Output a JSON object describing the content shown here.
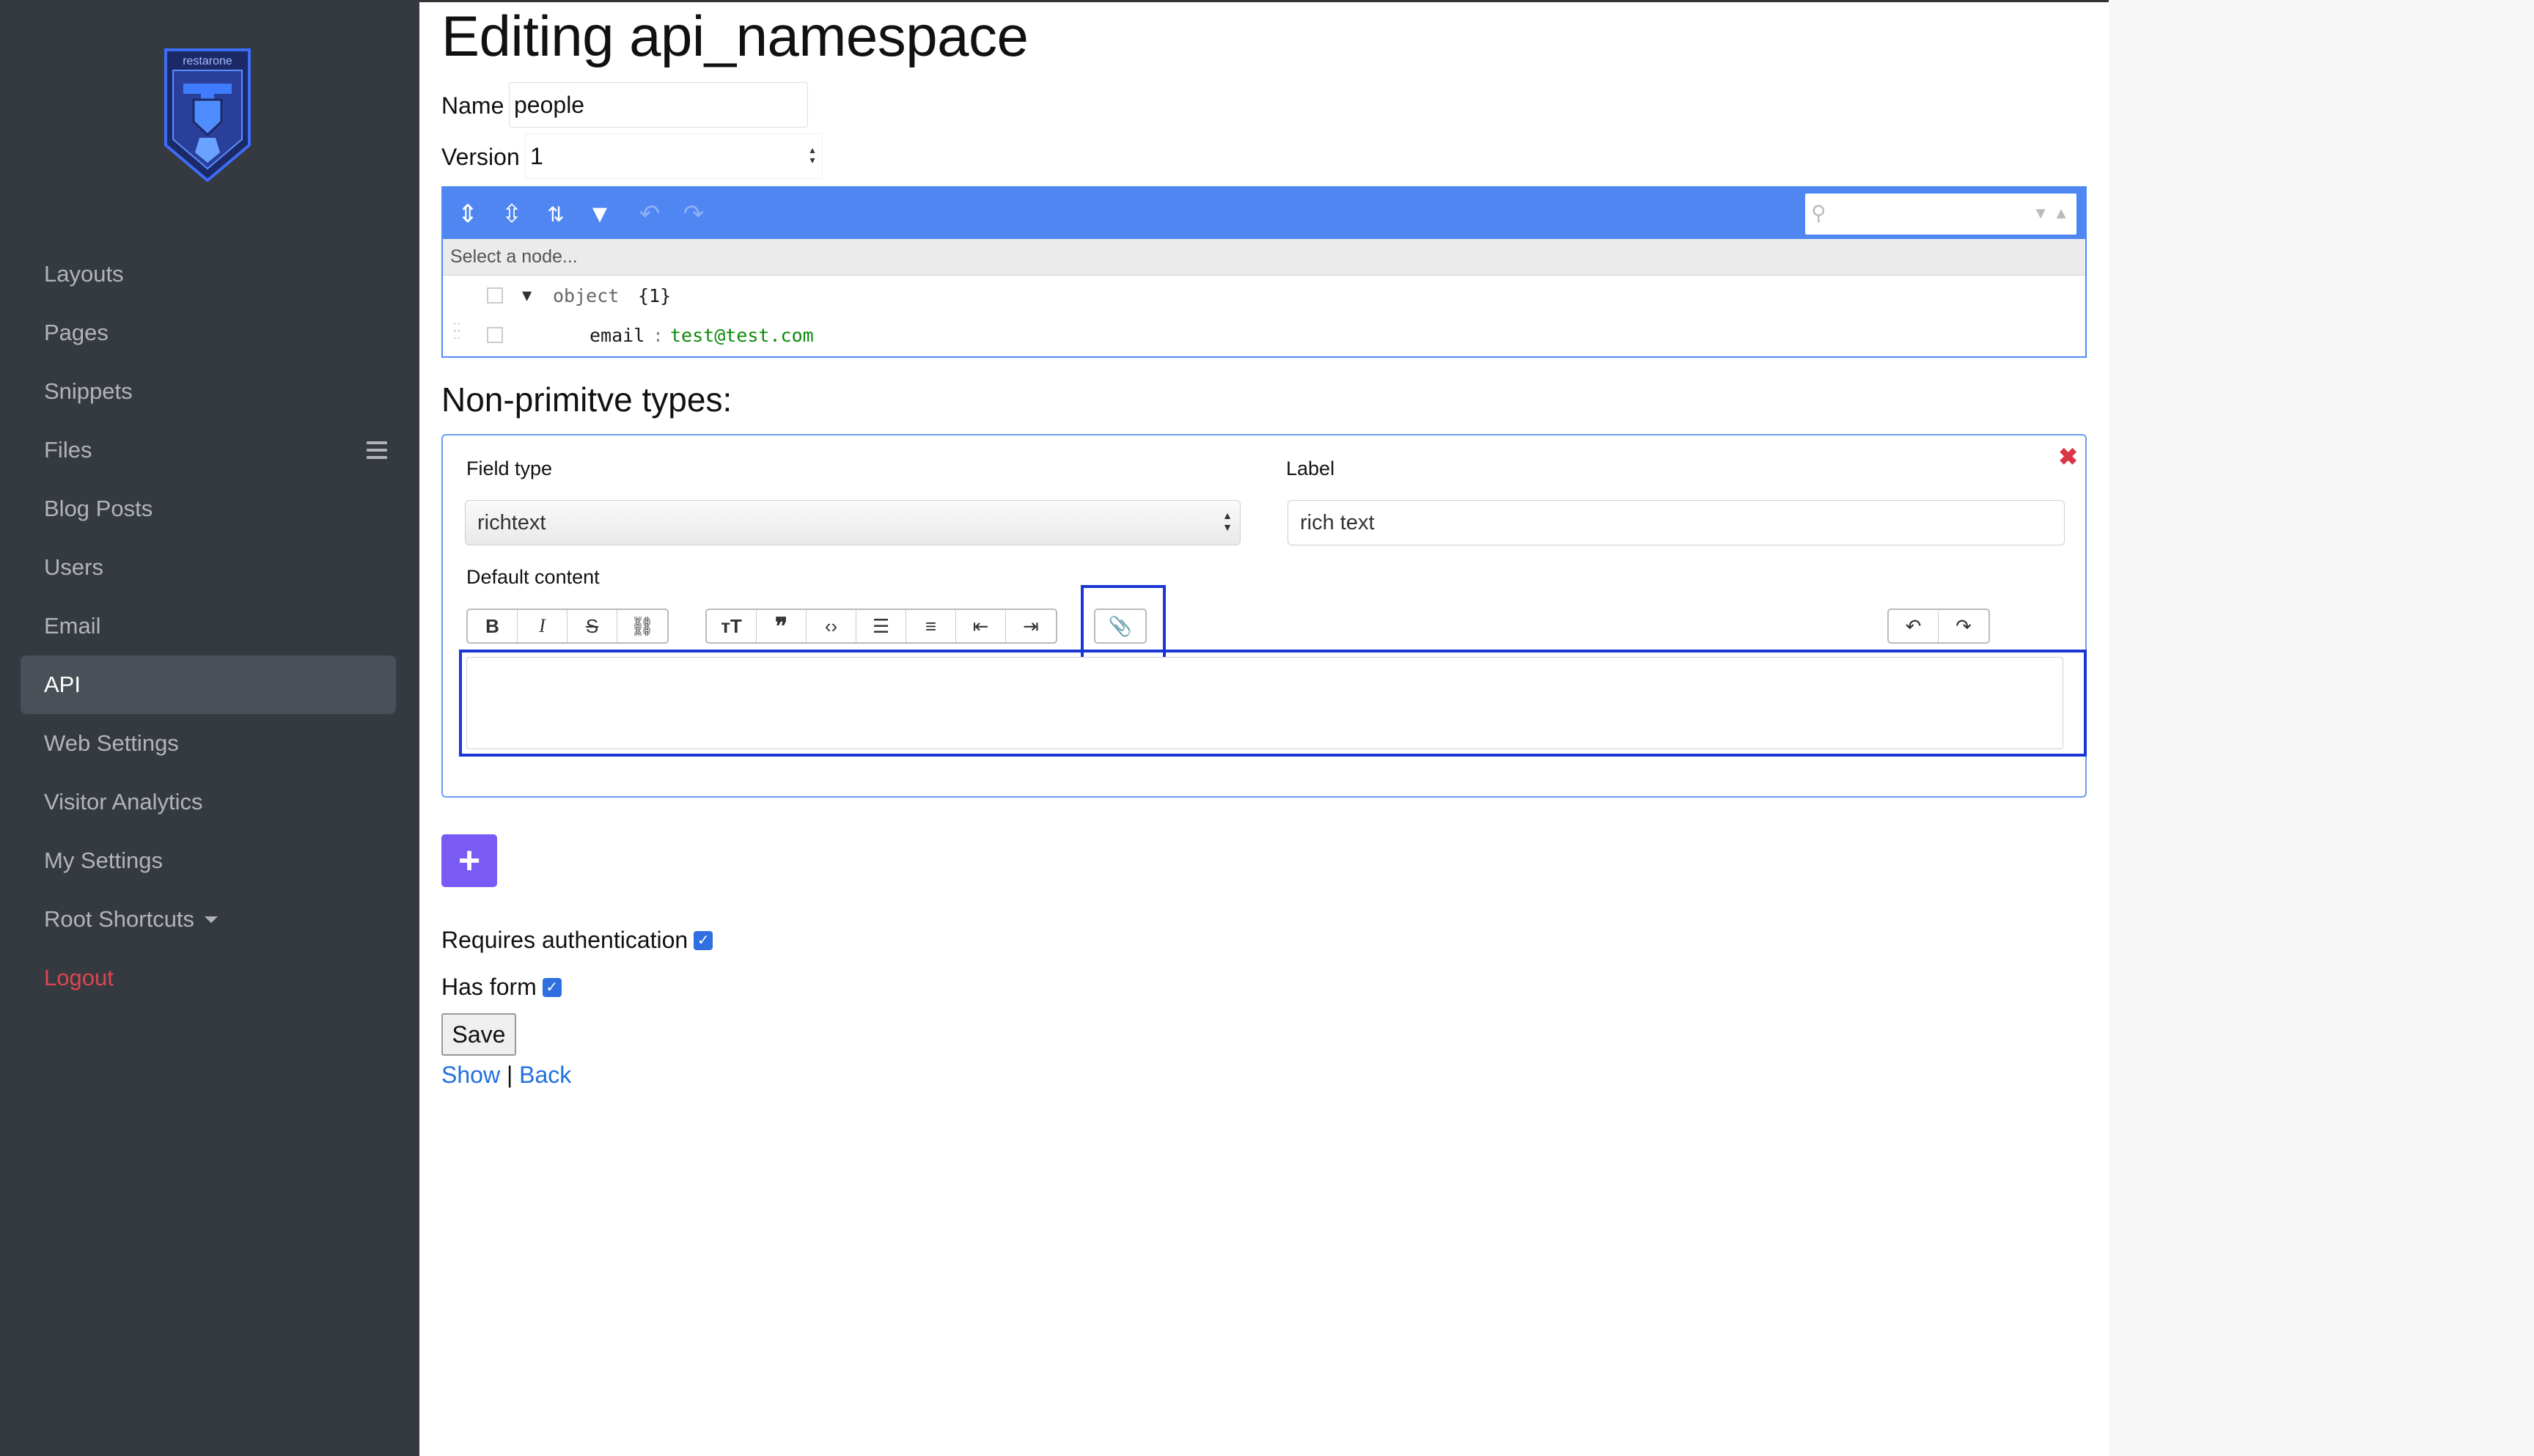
{
  "sidebar": {
    "logo_text": "restarone",
    "items": [
      {
        "label": "Layouts"
      },
      {
        "label": "Pages"
      },
      {
        "label": "Snippets"
      },
      {
        "label": "Files"
      },
      {
        "label": "Blog Posts"
      },
      {
        "label": "Users"
      },
      {
        "label": "Email"
      },
      {
        "label": "API"
      },
      {
        "label": "Web Settings"
      },
      {
        "label": "Visitor Analytics"
      },
      {
        "label": "My Settings"
      },
      {
        "label": "Root Shortcuts"
      },
      {
        "label": "Logout"
      }
    ]
  },
  "page": {
    "title": "Editing api_namespace",
    "name_label": "Name",
    "name_value": "people",
    "version_label": "Version",
    "version_value": "1"
  },
  "json_editor": {
    "nav_placeholder": "Select a node...",
    "root_label": "object",
    "root_count": "{1}",
    "field_key": "email",
    "field_sep": ":",
    "field_value": "test@test.com"
  },
  "non_primitive": {
    "title": "Non-primitve types:",
    "field_type_label": "Field type",
    "field_type_value": "richtext",
    "label_label": "Label",
    "label_value": "rich text",
    "default_content_label": "Default content"
  },
  "form": {
    "requires_auth_label": "Requires authentication",
    "requires_auth_checked": true,
    "has_form_label": "Has form",
    "has_form_checked": true,
    "save_label": "Save",
    "show_link": "Show",
    "separator": "|",
    "back_link": "Back"
  },
  "colors": {
    "sidebar_bg": "#343a40",
    "json_menu": "#4f86f2",
    "add_button": "#7a5af5",
    "logout": "#e0454f",
    "highlight": "#1a37d6"
  }
}
